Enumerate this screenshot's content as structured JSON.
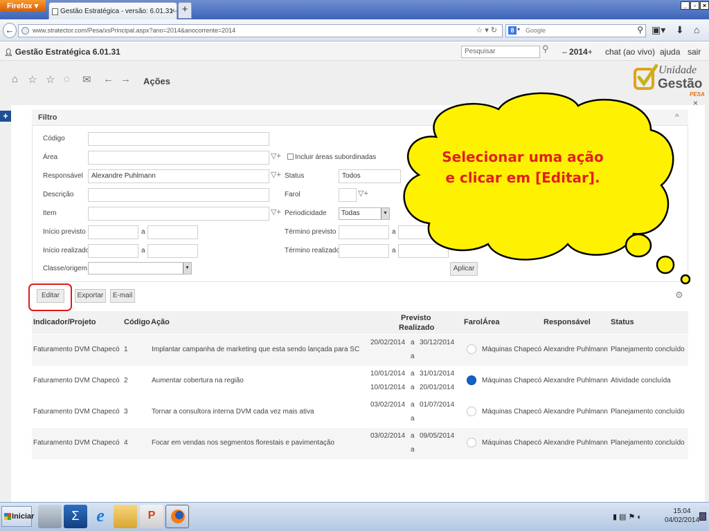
{
  "browser": {
    "menu_button": "Firefox",
    "tab_title": "Gestão Estratégica - versão: 6.01.31 - Login...",
    "tab_close": "×",
    "new_tab": "+",
    "url": "www.stratector.com/Pesa/xsPrincipal.aspx?ano=2014&anocorrente=2014",
    "search_engine": "Google",
    "search_placeholder": "Google"
  },
  "app": {
    "title": "Gestão Estratégica 6.01.31",
    "search_placeholder": "Pesquisar",
    "year_prev": "–",
    "year": "2014",
    "year_next": "+",
    "links": [
      "chat (ao vivo)",
      "ajuda",
      "sair"
    ],
    "page_title": "Ações",
    "logo": {
      "line1": "Unidade",
      "de": "de",
      "line2": "Gestão",
      "brand": "PESA"
    }
  },
  "filter": {
    "title": "Filtro",
    "fields": {
      "codigo": {
        "label": "Código",
        "value": ""
      },
      "area": {
        "label": "Área",
        "value": ""
      },
      "incluir_label": "Incluir áreas subordinadas",
      "responsavel": {
        "label": "Responsável",
        "value": "Alexandre Puhlmann"
      },
      "status": {
        "label": "Status",
        "value": "Todos"
      },
      "descricao": {
        "label": "Descrição",
        "value": ""
      },
      "farol": {
        "label": "Farol",
        "value": ""
      },
      "item": {
        "label": "Item",
        "value": ""
      },
      "periodicidade": {
        "label": "Periodicidade",
        "value": "Todas"
      },
      "inicio_previsto": {
        "label": "Início previsto",
        "sep": "a"
      },
      "termino_previsto": {
        "label": "Término previsto",
        "sep": "a"
      },
      "inicio_realizado": {
        "label": "Início realizado",
        "sep": "a"
      },
      "termino_realizado": {
        "label": "Término realizado",
        "sep": "a"
      },
      "classe": {
        "label": "Classe/origem",
        "value": ""
      }
    },
    "apply_label": "Aplicar"
  },
  "actions": {
    "edit": "Editar",
    "export": "Exportar",
    "email": "E-mail"
  },
  "table": {
    "headers": {
      "indicador": "Indicador/Projeto",
      "codigo": "Código",
      "acao": "Ação",
      "previsto": "Previsto",
      "realizado": "Realizado",
      "farol": "Farol",
      "area": "Área",
      "responsavel": "Responsável",
      "status": "Status"
    },
    "rows": [
      {
        "indicador": "Faturamento DVM Chapecó",
        "codigo": "1",
        "acao": "Implantar campanha de marketing que esta sendo lançada para SC",
        "prev_ini": "20/02/2014",
        "prev_sep": "a",
        "prev_fim": "30/12/2014",
        "real_ini": "",
        "real_sep": "a",
        "real_fim": "",
        "farol": "empty",
        "area": "Máquinas Chapecó",
        "responsavel": "Alexandre Puhlmann",
        "status": "Planejamento concluído"
      },
      {
        "indicador": "Faturamento DVM Chapecó",
        "codigo": "2",
        "acao": "Aumentar cobertura na região",
        "prev_ini": "10/01/2014",
        "prev_sep": "a",
        "prev_fim": "31/01/2014",
        "real_ini": "10/01/2014",
        "real_sep": "a",
        "real_fim": "20/01/2014",
        "farol": "blue",
        "area": "Máquinas Chapecó",
        "responsavel": "Alexandre Puhlmann",
        "status": "Atividade concluída"
      },
      {
        "indicador": "Faturamento DVM Chapecó",
        "codigo": "3",
        "acao": "Tornar a consultora interna DVM cada vez mais ativa",
        "prev_ini": "03/02/2014",
        "prev_sep": "a",
        "prev_fim": "01/07/2014",
        "real_ini": "",
        "real_sep": "a",
        "real_fim": "",
        "farol": "empty",
        "area": "Máquinas Chapecó",
        "responsavel": "Alexandre Puhlmann",
        "status": "Planejamento concluído"
      },
      {
        "indicador": "Faturamento DVM Chapecó",
        "codigo": "4",
        "acao": "Focar em vendas nos segmentos florestais e pavimentação",
        "prev_ini": "03/02/2014",
        "prev_sep": "a",
        "prev_fim": "09/05/2014",
        "real_ini": "",
        "real_sep": "a",
        "real_fim": "",
        "farol": "empty",
        "area": "Máquinas Chapecó",
        "responsavel": "Alexandre Puhlmann",
        "status": "Planejamento concluído"
      }
    ]
  },
  "callout": {
    "line1": "Selecionar uma ação",
    "line2": "e clicar em [Editar]."
  },
  "taskbar": {
    "start": "Iniciar",
    "time": "15:04",
    "date": "04/02/2014"
  },
  "colors": {
    "callout_fill": "#fff200",
    "callout_text": "#e21f1f",
    "highlight": "#e01818",
    "farol_done": "#1162c9"
  }
}
